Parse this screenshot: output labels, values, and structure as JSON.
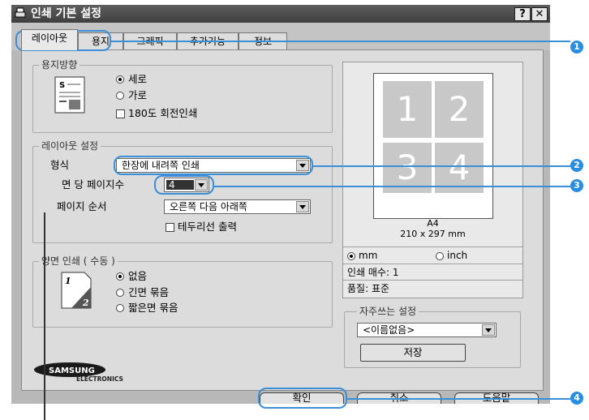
{
  "window": {
    "title": "인쇄 기본 설정",
    "help_btn": "?",
    "close_btn": "✕"
  },
  "tabs": [
    {
      "label": "레이아웃"
    },
    {
      "label": "용지"
    },
    {
      "label": "그래픽"
    },
    {
      "label": "추가기능"
    },
    {
      "label": "정보"
    }
  ],
  "orientation": {
    "group_label": "용지방향",
    "portrait": "세로",
    "landscape": "가로",
    "rotate180": "180도 회전인쇄",
    "selected": "portrait"
  },
  "layout": {
    "group_label": "레이아웃 설정",
    "type_label": "형식",
    "type_value": "한장에 내려쪽 인쇄",
    "pages_per_side_label": "면 당 페이지수",
    "pages_per_side_value": "4",
    "page_order_label": "페이지 순서",
    "page_order_value": "오른쪽 다음 아래쪽",
    "border_label": "테두리선 출력"
  },
  "duplex": {
    "group_label": "양면 인쇄 ( 수동 )",
    "none": "없음",
    "long_edge": "긴면 묶음",
    "short_edge": "짧은면 묶음",
    "selected": "none"
  },
  "preview": {
    "cells": [
      "1",
      "2",
      "3",
      "4"
    ],
    "paper_name": "A4",
    "paper_size": "210 x 297 mm",
    "unit_mm": "mm",
    "unit_inch": "inch",
    "unit_selected": "mm",
    "copies": "인쇄 매수: 1",
    "quality": "품질: 표준"
  },
  "favorites": {
    "group_label": "자주쓰는 설정",
    "value": "<이름없음>",
    "save_label": "저장"
  },
  "logo": {
    "brand": "SAMSUNG",
    "sub": "ELECTRONICS"
  },
  "buttons": {
    "ok": "확인",
    "cancel": "취소",
    "help": "도움말"
  },
  "callouts": [
    "1",
    "2",
    "3",
    "4"
  ],
  "colors": {
    "titlebar": "#4a4a4a",
    "callout": "#2a8ee0",
    "panel": "#dcdcdc"
  }
}
